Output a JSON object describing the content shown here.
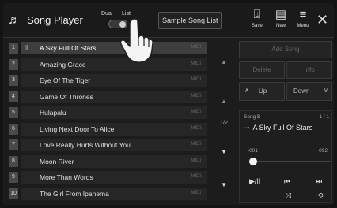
{
  "header": {
    "title": "Song Player",
    "mode_dual": "Dual",
    "mode_list": "List",
    "songlist_name": "Sample Song List",
    "save_label": "Save",
    "new_label": "New",
    "menu_label": "Menu",
    "close_glyph": "✕"
  },
  "songs": [
    {
      "num": "1",
      "title": "A Sky Full Of Stars",
      "tag": "MIDI",
      "play": "II"
    },
    {
      "num": "2",
      "title": "Amazing Grace",
      "tag": "MIDI",
      "play": ""
    },
    {
      "num": "3",
      "title": "Eye Of The Tiger",
      "tag": "MIDI",
      "play": ""
    },
    {
      "num": "4",
      "title": "Game Of Thrones",
      "tag": "MIDI",
      "play": ""
    },
    {
      "num": "5",
      "title": "Hulapalu",
      "tag": "MIDI",
      "play": ""
    },
    {
      "num": "6",
      "title": "Living Next Door To Alice",
      "tag": "MIDI",
      "play": ""
    },
    {
      "num": "7",
      "title": "Love Really Hurts Without You",
      "tag": "MIDI",
      "play": ""
    },
    {
      "num": "8",
      "title": "Moon River",
      "tag": "MIDI",
      "play": ""
    },
    {
      "num": "9",
      "title": "More Than Words",
      "tag": "MIDI",
      "play": ""
    },
    {
      "num": "10",
      "title": "The Girl From Ipanema",
      "tag": "MIDI",
      "play": ""
    }
  ],
  "selected_index": 0,
  "middle": {
    "top_glyph": "▲",
    "up_glyph": "▲",
    "page": "1/2",
    "down_glyph": "▼",
    "bottom_glyph": "▼"
  },
  "panel": {
    "add_song": "Add Song",
    "delete": "Delete",
    "info": "Info",
    "up": "Up",
    "down": "Down",
    "up_glyph": "∧",
    "down_glyph": "∨"
  },
  "player": {
    "song_label": "Song B",
    "count": "1 / 1",
    "now_playing": "A Sky Full Of Stars",
    "time_start": "-001",
    "time_end": "092",
    "position": 0.0,
    "play_pause_glyph": "▶/II",
    "prev_glyph": "⏮",
    "next_glyph": "⏭",
    "shuffle_glyph": "⤨",
    "repeat_glyph": "⟲"
  },
  "colors": {
    "background": "#1c1c1c",
    "row": "#262626",
    "row_selected": "#3e3e3e",
    "number_tab": "#4a4a4a"
  }
}
